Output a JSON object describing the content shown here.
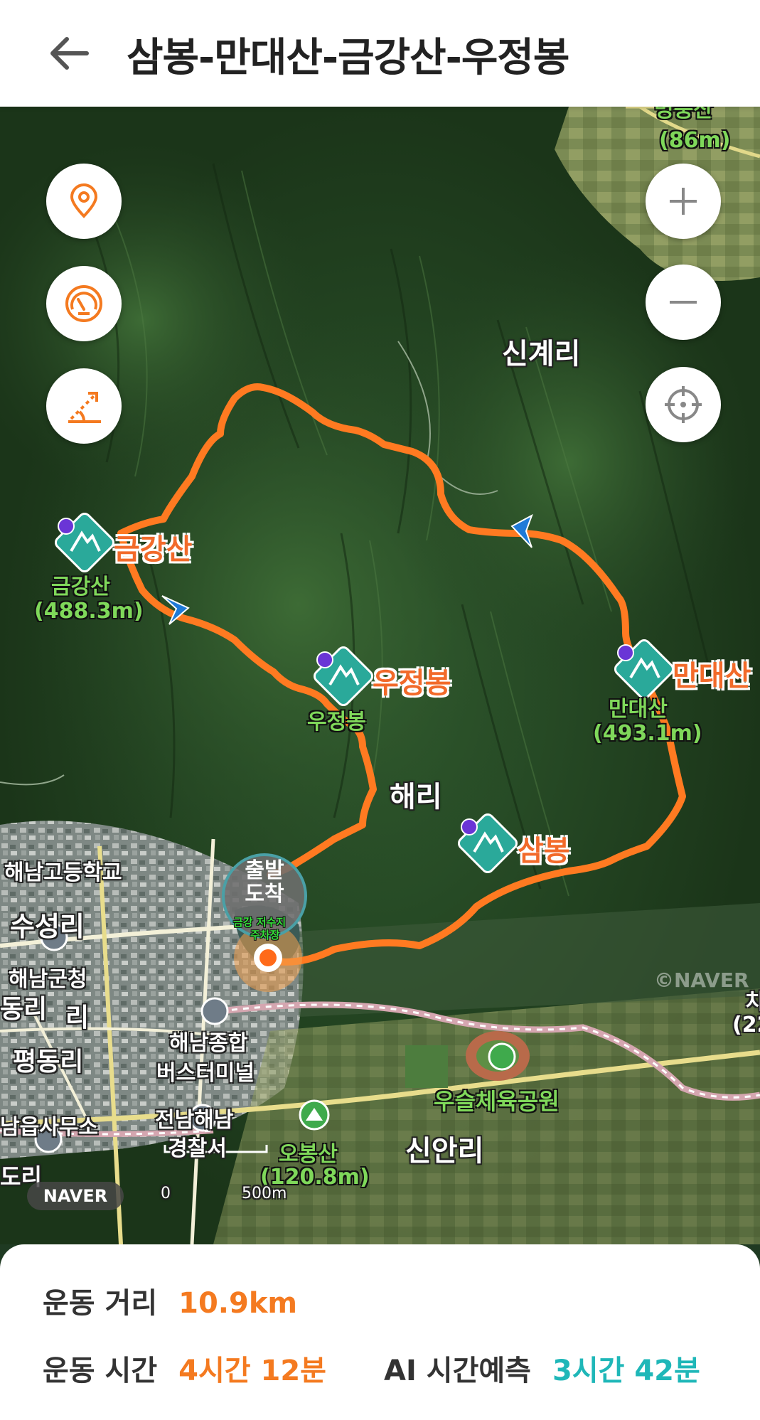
{
  "header": {
    "title": "삼봉-만대산-금강산-우정봉"
  },
  "colors": {
    "route": "#ff7a21",
    "accent": "#f47a20",
    "teal": "#1fb7b8",
    "peak_marker": "#2aa99a"
  },
  "map": {
    "places": {
      "singyeri": "신계리",
      "haeri": "해리",
      "haenam_high": "해남고등학교",
      "suseongri": "수성리",
      "haenam_gun": "해남군청",
      "dongri": "동리",
      "ri": "리",
      "pyeongdongri": "평동리",
      "bus_terminal_1": "해남종합",
      "bus_terminal_2": "버스터미널",
      "police_1": "전남해남",
      "police_2": "경찰서",
      "office": "남읍사무소",
      "dori": "도리",
      "sinanri": "신안리",
      "usul_park": "우슬체육공원",
      "edge_right": "치",
      "edge_right_alt": "(22"
    },
    "peaks": {
      "geumgang": {
        "name": "금강산",
        "label": "금강산",
        "elevation": "(488.3m)"
      },
      "ujeong": {
        "name": "우정봉",
        "label": "우정봉"
      },
      "mandae": {
        "name": "만대산",
        "label": "만대산",
        "elevation": "(493.1m)"
      },
      "sambong": {
        "name": "삼봉"
      },
      "obong": {
        "label": "오봉산",
        "elevation": "(120.8m)"
      },
      "myeongpung": {
        "label": "명풍산",
        "elevation": "(86m)"
      }
    },
    "start_marker": {
      "line1": "출발",
      "line2": "도착",
      "sub1": "금강 저수지",
      "sub2": "주차장"
    },
    "naver_logo": "NAVER",
    "watermark": "©NAVER",
    "scale": "500m",
    "scale_zero": "0"
  },
  "controls": {
    "left": [
      "location-pin-icon",
      "speedometer-icon",
      "slope-icon"
    ],
    "right": [
      "zoom-in-icon",
      "zoom-out-icon",
      "crosshair-icon"
    ]
  },
  "stats": {
    "distance_label": "운동 거리",
    "distance_value": "10.9km",
    "time_label": "운동 시간",
    "time_value": "4시간 12분",
    "ai_label": "AI 시간예측",
    "ai_value": "3시간 42분"
  }
}
